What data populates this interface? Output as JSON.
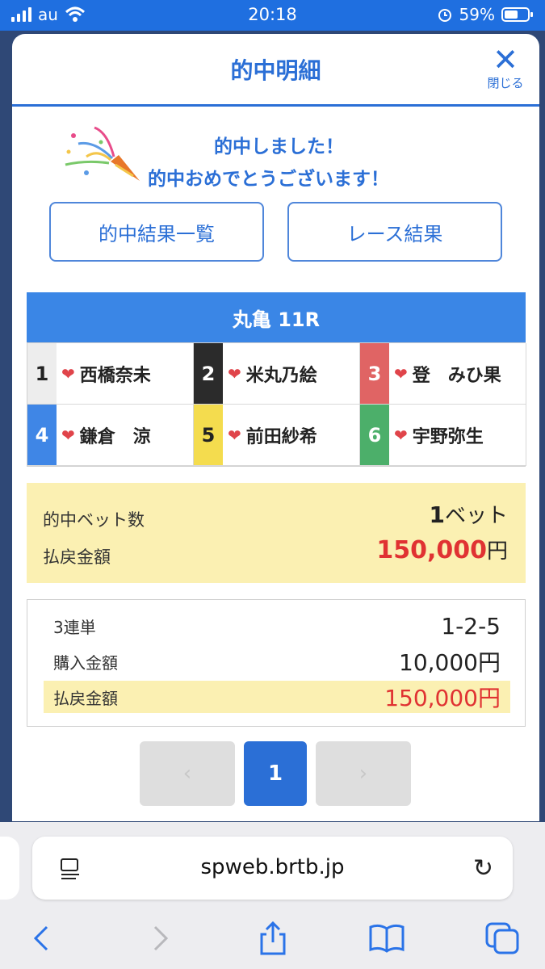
{
  "status_bar": {
    "carrier": "au",
    "time": "20:18",
    "battery": "59%"
  },
  "modal": {
    "title": "的中明細",
    "close_label": "閉じる",
    "congrats_line1": "的中しました！",
    "congrats_line2": "的中おめでとうございます！",
    "btn_hits": "的中結果一覧",
    "btn_race_results": "レース結果",
    "race_name": "丸亀 11R",
    "entries": [
      {
        "num": "1",
        "name": "西橋奈未",
        "bg": "#ededed",
        "fg": "#222222"
      },
      {
        "num": "2",
        "name": "米丸乃絵",
        "bg": "#2b2b2b",
        "fg": "#ffffff"
      },
      {
        "num": "3",
        "name": "登　みひ果",
        "bg": "#e06464",
        "fg": "#ffffff"
      },
      {
        "num": "4",
        "name": "鎌倉　涼",
        "bg": "#3f86e6",
        "fg": "#ffffff"
      },
      {
        "num": "5",
        "name": "前田紗希",
        "bg": "#f4dc4e",
        "fg": "#222222"
      },
      {
        "num": "6",
        "name": "宇野弥生",
        "bg": "#4caf6a",
        "fg": "#ffffff"
      }
    ],
    "summary": {
      "bets_label": "的中ベット数",
      "bets_value": "1",
      "bets_unit": "ベット",
      "payout_label": "払戻金額",
      "payout_value": "150,000",
      "payout_unit": "円"
    },
    "detail": {
      "bet_type": "3連単",
      "combination": "1-2-5",
      "purchase_label": "購入金額",
      "purchase_value": "10,000円",
      "payout_label": "払戻金額",
      "payout_value": "150,000円"
    },
    "pager": {
      "prev": "‹",
      "current": "1",
      "next": "›"
    }
  },
  "browser": {
    "url": "spweb.brtb.jp"
  },
  "colors": {
    "accent": "#2b6fd6",
    "highlight": "#fbf0b2",
    "payout": "#e03232"
  }
}
